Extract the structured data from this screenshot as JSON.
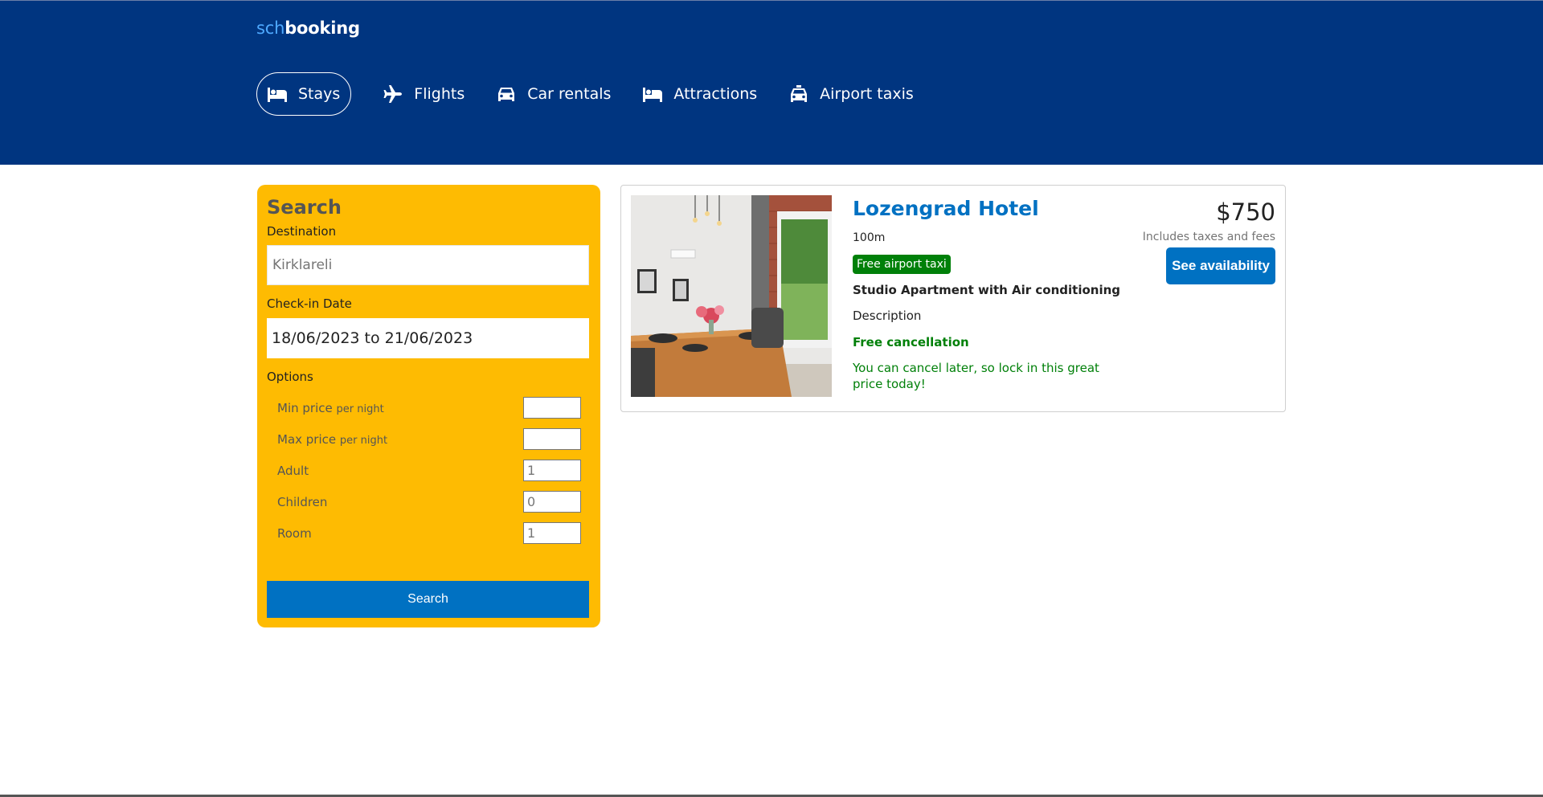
{
  "header": {
    "logo_part1": "sch",
    "logo_part2": "booking",
    "nav": [
      {
        "label": "Stays",
        "icon": "bed-icon"
      },
      {
        "label": "Flights",
        "icon": "plane-icon"
      },
      {
        "label": "Car rentals",
        "icon": "car-icon"
      },
      {
        "label": "Attractions",
        "icon": "bed-icon"
      },
      {
        "label": "Airport taxis",
        "icon": "taxi-icon"
      }
    ]
  },
  "search": {
    "title": "Search",
    "destination_label": "Destination",
    "destination_placeholder": "Kirklareli",
    "checkin_label": "Check-in Date",
    "checkin_value": "18/06/2023 to 21/06/2023",
    "options_label": "Options",
    "options": [
      {
        "label": "Min price",
        "suffix": "per night",
        "value": ""
      },
      {
        "label": "Max price",
        "suffix": "per night",
        "value": ""
      },
      {
        "label": "Adult",
        "suffix": "",
        "value": "1"
      },
      {
        "label": "Children",
        "suffix": "",
        "value": "0"
      },
      {
        "label": "Room",
        "suffix": "",
        "value": "1"
      }
    ],
    "button_label": "Search"
  },
  "result": {
    "name": "Lozengrad Hotel",
    "distance": "100m",
    "taxi_badge": "Free airport taxi",
    "room_type": "Studio Apartment with Air conditioning",
    "description": "Description",
    "cancellation": "Free cancellation",
    "cancellation_sub": "You can cancel later, so lock in this great price today!",
    "price": "$750",
    "tax_note": "Includes taxes and fees",
    "availability_button": "See availability"
  },
  "colors": {
    "header_bg": "#003580",
    "sidebar_bg": "#febb02",
    "primary_blue": "#0071c2",
    "green": "#008009"
  }
}
